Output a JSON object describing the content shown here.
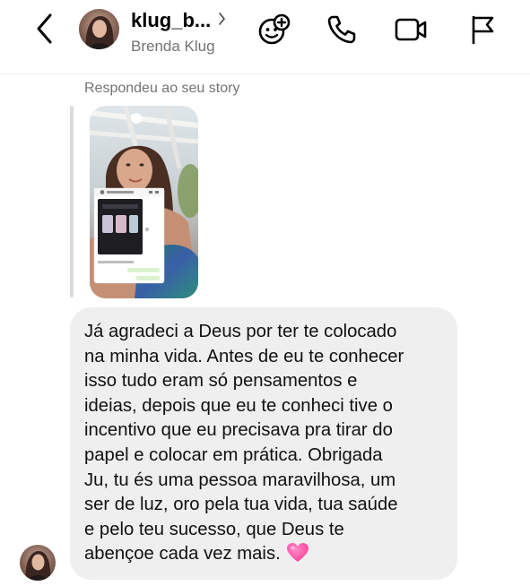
{
  "header": {
    "username": "klug_b...",
    "full_name": "Brenda Klug",
    "icons": {
      "back": "chevron-left-icon",
      "profile_chevron": "chevron-right-icon",
      "effects": "face-plus-icon",
      "call": "phone-icon",
      "video": "video-camera-icon",
      "report": "flag-icon"
    }
  },
  "thread": {
    "story_reply_note": "Respondeu ao seu story",
    "message_text": "Já agradeci a Deus por ter te colocado\nna minha vida. Antes de eu te conhecer\nisso tudo eram só pensamentos e\nideias, depois que eu te conheci tive o\nincentivo que eu precisava pra tirar do\npapel e colocar em prática. Obrigada\nJu, tu és uma pessoa maravilhosa, um\nser de luz, oro pela tua vida, tua saúde\ne pelo teu sucesso, que Deus te\nabençoe cada vez mais.",
    "message_emoji": "pink-heart-icon"
  },
  "colors": {
    "bubble": "#efefef",
    "secondary_text": "#737373",
    "heart": "#ff4fa3",
    "text": "#111111"
  }
}
